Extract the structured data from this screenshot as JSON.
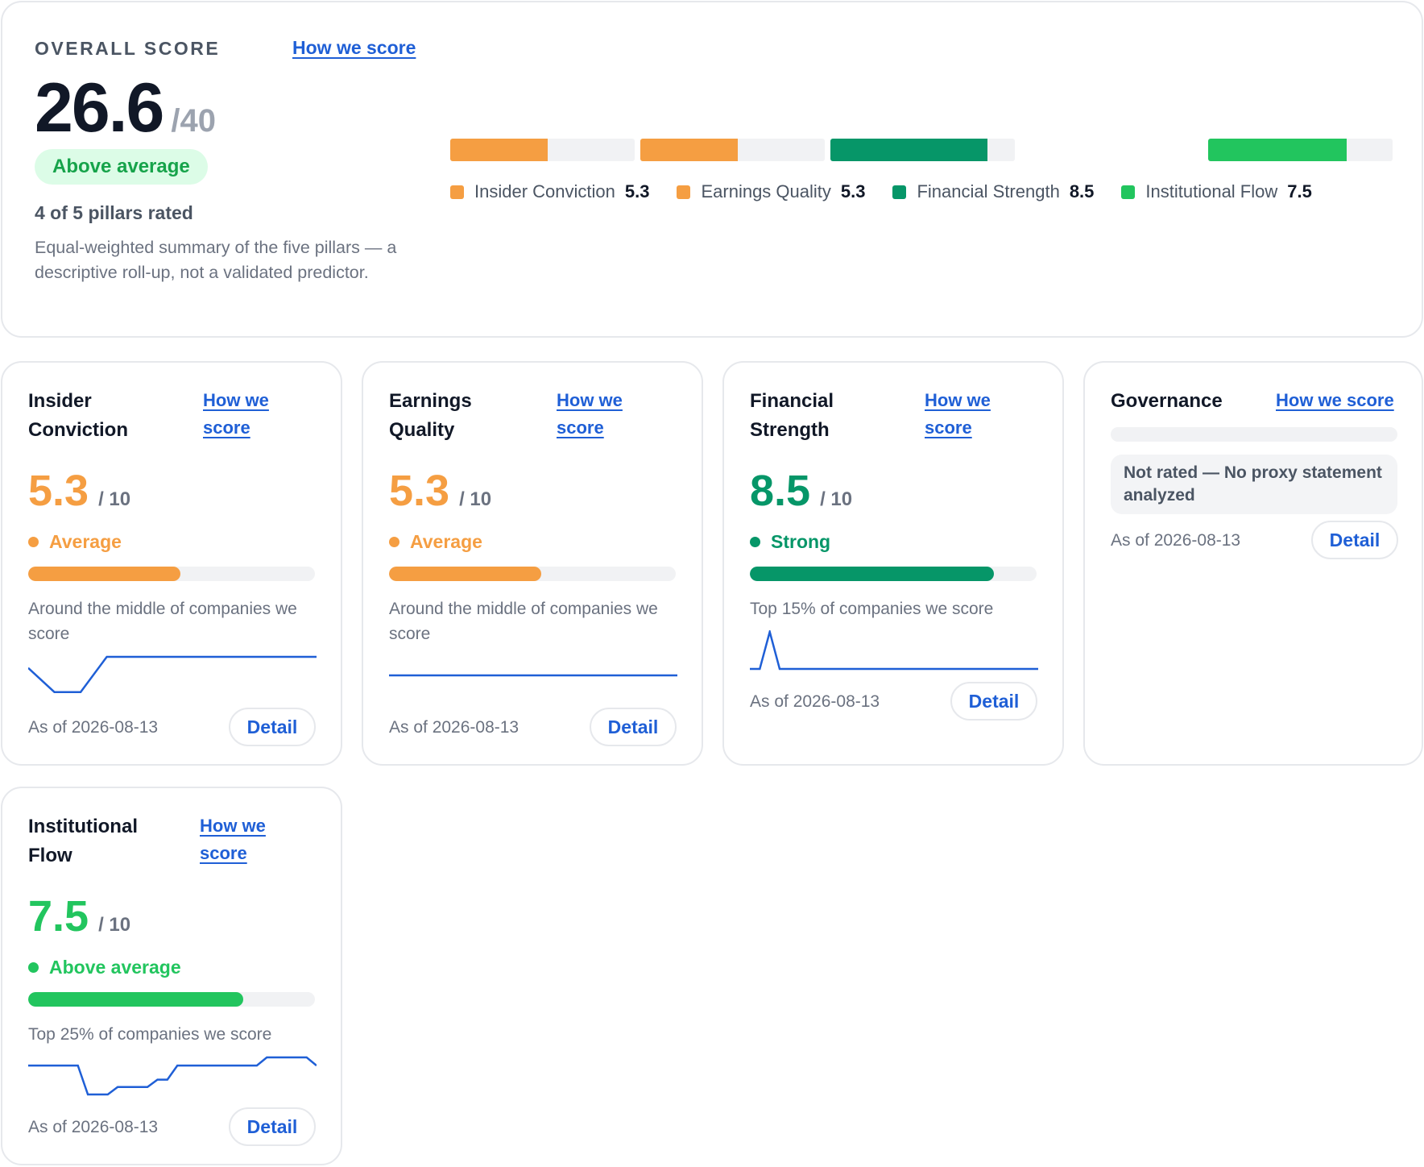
{
  "overall": {
    "label": "OVERALL SCORE",
    "how_link": "How we score",
    "score": "26.6",
    "denominator": "/40",
    "badge": "Above average",
    "rated": "4 of 5 pillars rated",
    "description": "Equal-weighted summary of the five pillars — a descriptive roll-up, not a validated predictor.",
    "bars": [
      {
        "name": "Insider Conviction",
        "value": 5.3,
        "color": "#f59e42"
      },
      {
        "name": "Earnings Quality",
        "value": 5.3,
        "color": "#f59e42"
      },
      {
        "name": "Financial Strength",
        "value": 8.5,
        "color": "#069668"
      },
      {
        "name": "Governance",
        "value": null,
        "color": "#f1f2f4"
      },
      {
        "name": "Institutional Flow",
        "value": 7.5,
        "color": "#22c55e"
      }
    ],
    "legend": [
      {
        "name": "Insider Conviction",
        "value": "5.3",
        "color": "#f59e42"
      },
      {
        "name": "Earnings Quality",
        "value": "5.3",
        "color": "#f59e42"
      },
      {
        "name": "Financial Strength",
        "value": "8.5",
        "color": "#069668"
      },
      {
        "name": "Institutional Flow",
        "value": "7.5",
        "color": "#22c55e"
      }
    ]
  },
  "pillars": {
    "insider": {
      "title": "Insider Conviction",
      "how_link": "How we score",
      "score": "5.3",
      "denominator": "/ 10",
      "status": "Average",
      "color": "#f59e42",
      "fill_fraction": 0.53,
      "description": "Around the middle of companies we score",
      "spark": [
        0.7,
        0.05,
        0.05,
        1,
        1,
        1,
        1,
        1,
        1,
        1,
        1,
        1
      ],
      "as_of": "As of 2026-08-13",
      "detail": "Detail"
    },
    "earnings": {
      "title": "Earnings Quality",
      "how_link": "How we score",
      "score": "5.3",
      "denominator": "/ 10",
      "status": "Average",
      "color": "#f59e42",
      "fill_fraction": 0.53,
      "description": "Around the middle of companies we score",
      "spark": [
        0.5,
        0.5
      ],
      "as_of": "As of 2026-08-13",
      "detail": "Detail"
    },
    "financial": {
      "title": "Financial Strength",
      "how_link": "How we score",
      "score": "8.5",
      "denominator": "/ 10",
      "status": "Strong",
      "color": "#069668",
      "fill_fraction": 0.85,
      "description": "Top 15% of companies we score",
      "spark": [
        0,
        0,
        1,
        0,
        0,
        0,
        0,
        0,
        0,
        0,
        0,
        0,
        0,
        0,
        0,
        0,
        0,
        0,
        0,
        0,
        0,
        0,
        0,
        0,
        0,
        0,
        0,
        0,
        0,
        0
      ],
      "as_of": "As of 2026-08-13",
      "detail": "Detail"
    },
    "governance": {
      "title": "Governance",
      "how_link": "How we score",
      "not_rated": "Not rated — No proxy statement analyzed",
      "as_of": "As of 2026-08-13",
      "detail": "Detail"
    },
    "institutional": {
      "title": "Institutional Flow",
      "how_link": "How we score",
      "score": "7.5",
      "denominator": "/ 10",
      "status": "Above average",
      "color": "#22c55e",
      "fill_fraction": 0.75,
      "description": "Top 25% of companies we score",
      "spark": [
        0.78,
        0.78,
        0.78,
        0.78,
        0.78,
        0.78,
        0.0,
        0.0,
        0.0,
        0.2,
        0.2,
        0.2,
        0.2,
        0.4,
        0.4,
        0.78,
        0.78,
        0.78,
        0.78,
        0.78,
        0.78,
        0.78,
        0.78,
        0.78,
        1.0,
        1.0,
        1.0,
        1.0,
        1.0,
        0.78
      ],
      "as_of": "As of 2026-08-13",
      "detail": "Detail"
    }
  }
}
